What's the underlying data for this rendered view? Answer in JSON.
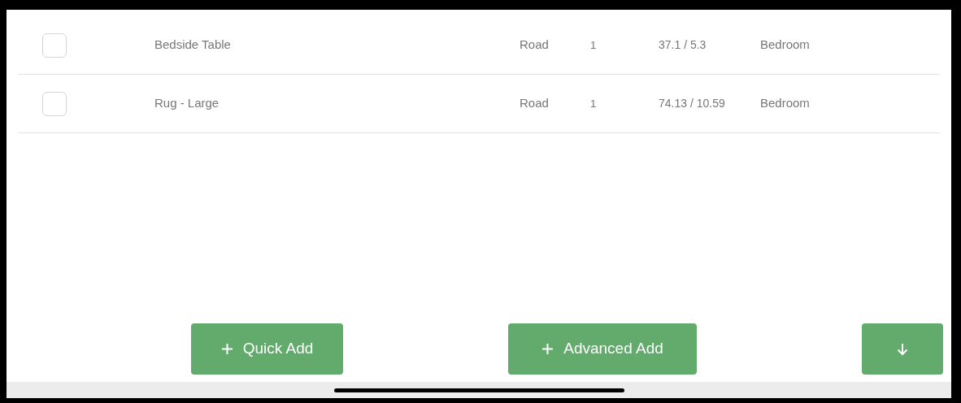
{
  "rows": [
    {
      "checked": false,
      "name": "Bedside Table",
      "transport": "Road",
      "quantity": "1",
      "weight": "37.1 / 5.3",
      "room": "Bedroom"
    },
    {
      "checked": false,
      "name": "Rug - Large",
      "transport": "Road",
      "quantity": "1",
      "weight": "74.13 / 10.59",
      "room": "Bedroom"
    }
  ],
  "buttons": [
    {
      "kind": "plus",
      "label": "Quick Add"
    },
    {
      "kind": "plus",
      "label": "Advanced Add"
    },
    {
      "kind": "down"
    }
  ]
}
